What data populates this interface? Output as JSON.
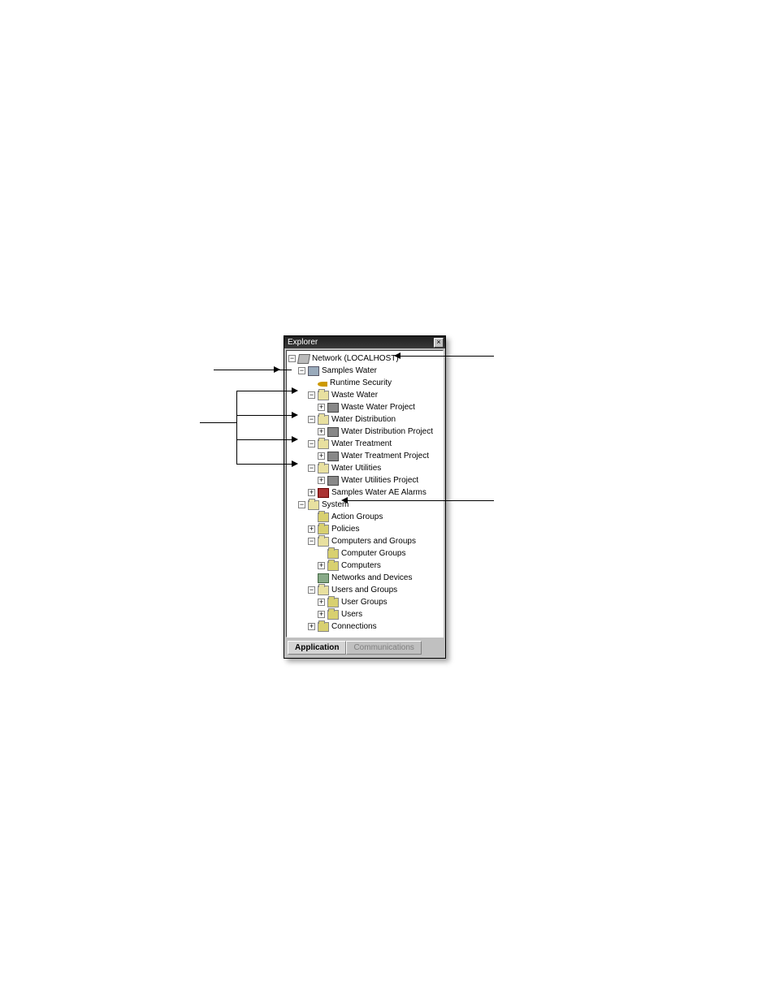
{
  "panel": {
    "title": "Explorer"
  },
  "tree": {
    "root": "Network (LOCALHOST)",
    "samples_water": "Samples Water",
    "runtime_security": "Runtime Security",
    "waste_water": "Waste Water",
    "waste_water_project": "Waste Water Project",
    "water_distribution": "Water Distribution",
    "water_distribution_project": "Water Distribution Project",
    "water_treatment": "Water Treatment",
    "water_treatment_project": "Water Treatment Project",
    "water_utilities": "Water Utilities",
    "water_utilities_project": "Water Utilities Project",
    "samples_water_ae_alarms": "Samples Water AE Alarms",
    "system": "System",
    "action_groups": "Action Groups",
    "policies": "Policies",
    "computers_and_groups": "Computers and Groups",
    "computer_groups": "Computer Groups",
    "computers": "Computers",
    "networks_and_devices": "Networks and Devices",
    "users_and_groups": "Users and Groups",
    "user_groups": "User Groups",
    "users": "Users",
    "connections": "Connections"
  },
  "tabs": {
    "application": "Application",
    "communications": "Communications"
  }
}
